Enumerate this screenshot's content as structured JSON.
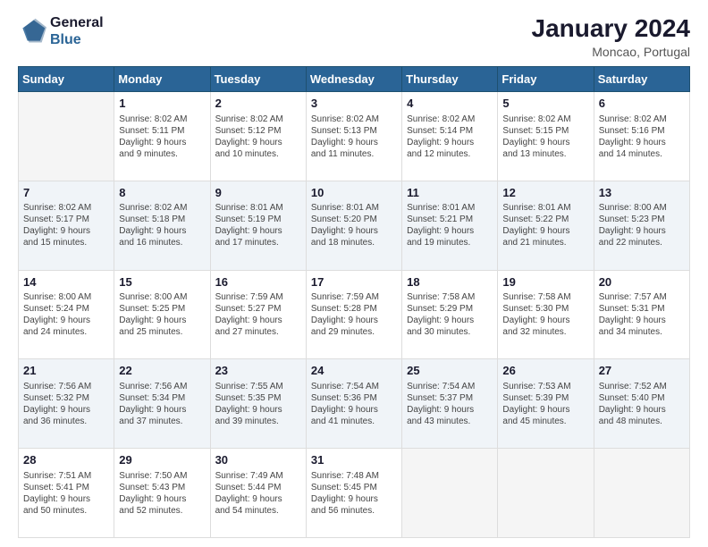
{
  "header": {
    "logo": {
      "line1": "General",
      "line2": "Blue"
    },
    "title": "January 2024",
    "subtitle": "Moncao, Portugal"
  },
  "weekdays": [
    "Sunday",
    "Monday",
    "Tuesday",
    "Wednesday",
    "Thursday",
    "Friday",
    "Saturday"
  ],
  "weeks": [
    [
      {
        "day": "",
        "info": ""
      },
      {
        "day": "1",
        "info": "Sunrise: 8:02 AM\nSunset: 5:11 PM\nDaylight: 9 hours\nand 9 minutes."
      },
      {
        "day": "2",
        "info": "Sunrise: 8:02 AM\nSunset: 5:12 PM\nDaylight: 9 hours\nand 10 minutes."
      },
      {
        "day": "3",
        "info": "Sunrise: 8:02 AM\nSunset: 5:13 PM\nDaylight: 9 hours\nand 11 minutes."
      },
      {
        "day": "4",
        "info": "Sunrise: 8:02 AM\nSunset: 5:14 PM\nDaylight: 9 hours\nand 12 minutes."
      },
      {
        "day": "5",
        "info": "Sunrise: 8:02 AM\nSunset: 5:15 PM\nDaylight: 9 hours\nand 13 minutes."
      },
      {
        "day": "6",
        "info": "Sunrise: 8:02 AM\nSunset: 5:16 PM\nDaylight: 9 hours\nand 14 minutes."
      }
    ],
    [
      {
        "day": "7",
        "info": "Sunrise: 8:02 AM\nSunset: 5:17 PM\nDaylight: 9 hours\nand 15 minutes."
      },
      {
        "day": "8",
        "info": "Sunrise: 8:02 AM\nSunset: 5:18 PM\nDaylight: 9 hours\nand 16 minutes."
      },
      {
        "day": "9",
        "info": "Sunrise: 8:01 AM\nSunset: 5:19 PM\nDaylight: 9 hours\nand 17 minutes."
      },
      {
        "day": "10",
        "info": "Sunrise: 8:01 AM\nSunset: 5:20 PM\nDaylight: 9 hours\nand 18 minutes."
      },
      {
        "day": "11",
        "info": "Sunrise: 8:01 AM\nSunset: 5:21 PM\nDaylight: 9 hours\nand 19 minutes."
      },
      {
        "day": "12",
        "info": "Sunrise: 8:01 AM\nSunset: 5:22 PM\nDaylight: 9 hours\nand 21 minutes."
      },
      {
        "day": "13",
        "info": "Sunrise: 8:00 AM\nSunset: 5:23 PM\nDaylight: 9 hours\nand 22 minutes."
      }
    ],
    [
      {
        "day": "14",
        "info": "Sunrise: 8:00 AM\nSunset: 5:24 PM\nDaylight: 9 hours\nand 24 minutes."
      },
      {
        "day": "15",
        "info": "Sunrise: 8:00 AM\nSunset: 5:25 PM\nDaylight: 9 hours\nand 25 minutes."
      },
      {
        "day": "16",
        "info": "Sunrise: 7:59 AM\nSunset: 5:27 PM\nDaylight: 9 hours\nand 27 minutes."
      },
      {
        "day": "17",
        "info": "Sunrise: 7:59 AM\nSunset: 5:28 PM\nDaylight: 9 hours\nand 29 minutes."
      },
      {
        "day": "18",
        "info": "Sunrise: 7:58 AM\nSunset: 5:29 PM\nDaylight: 9 hours\nand 30 minutes."
      },
      {
        "day": "19",
        "info": "Sunrise: 7:58 AM\nSunset: 5:30 PM\nDaylight: 9 hours\nand 32 minutes."
      },
      {
        "day": "20",
        "info": "Sunrise: 7:57 AM\nSunset: 5:31 PM\nDaylight: 9 hours\nand 34 minutes."
      }
    ],
    [
      {
        "day": "21",
        "info": "Sunrise: 7:56 AM\nSunset: 5:32 PM\nDaylight: 9 hours\nand 36 minutes."
      },
      {
        "day": "22",
        "info": "Sunrise: 7:56 AM\nSunset: 5:34 PM\nDaylight: 9 hours\nand 37 minutes."
      },
      {
        "day": "23",
        "info": "Sunrise: 7:55 AM\nSunset: 5:35 PM\nDaylight: 9 hours\nand 39 minutes."
      },
      {
        "day": "24",
        "info": "Sunrise: 7:54 AM\nSunset: 5:36 PM\nDaylight: 9 hours\nand 41 minutes."
      },
      {
        "day": "25",
        "info": "Sunrise: 7:54 AM\nSunset: 5:37 PM\nDaylight: 9 hours\nand 43 minutes."
      },
      {
        "day": "26",
        "info": "Sunrise: 7:53 AM\nSunset: 5:39 PM\nDaylight: 9 hours\nand 45 minutes."
      },
      {
        "day": "27",
        "info": "Sunrise: 7:52 AM\nSunset: 5:40 PM\nDaylight: 9 hours\nand 48 minutes."
      }
    ],
    [
      {
        "day": "28",
        "info": "Sunrise: 7:51 AM\nSunset: 5:41 PM\nDaylight: 9 hours\nand 50 minutes."
      },
      {
        "day": "29",
        "info": "Sunrise: 7:50 AM\nSunset: 5:43 PM\nDaylight: 9 hours\nand 52 minutes."
      },
      {
        "day": "30",
        "info": "Sunrise: 7:49 AM\nSunset: 5:44 PM\nDaylight: 9 hours\nand 54 minutes."
      },
      {
        "day": "31",
        "info": "Sunrise: 7:48 AM\nSunset: 5:45 PM\nDaylight: 9 hours\nand 56 minutes."
      },
      {
        "day": "",
        "info": ""
      },
      {
        "day": "",
        "info": ""
      },
      {
        "day": "",
        "info": ""
      }
    ]
  ]
}
